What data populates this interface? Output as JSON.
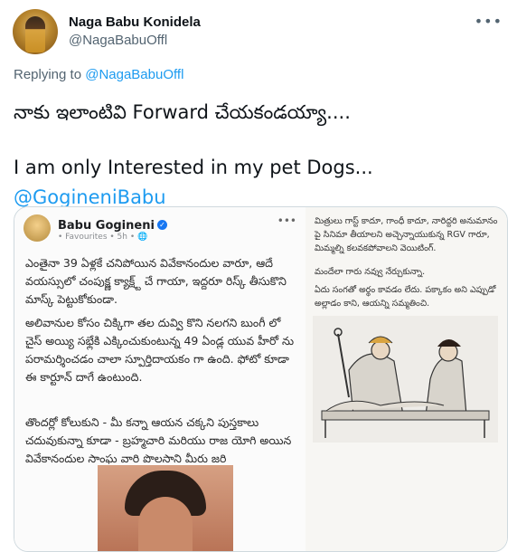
{
  "header": {
    "display_name": "Naga Babu Konidela",
    "handle": "@NagaBabuOffl",
    "more_icon": "more-horizontal-icon"
  },
  "reply": {
    "prefix": "Replying to",
    "to": "@NagaBabuOffl"
  },
  "tweet": {
    "line1": "నాకు ఇలాంటివి Forward చేయకండయ్యా....",
    "line2": "I am only Interested in my pet Dogs...",
    "mention": "@GogineniBabu"
  },
  "media": {
    "post": {
      "author": "Babu Gogineni",
      "meta": "• Favourites • 5h • 🌐",
      "paragraphs": [
        "ఎంతైనా 39 ఏళ్లకే చనిపోయిన వివేకానందుల వారూ, ఆదే వయస్సులో చంపుక్ష్ణ క్యాక్ష్ట్ చే గాయా, ఇద్దరూ రిస్క్ తీసుకొని మాస్క్ పెట్టుకోకుండా.",
        "అలివానుల కోసం చిక్కిగా తల దువ్వి కొని నలగని బుంగీ లో చైస్ అయ్యి సభ్లేకి ఎక్కించుకుంటున్న 49 ఏండ్ల యువ హీరో ను పరామర్శించడం చాలా స్పూర్తిదాయకం గా ఉంది. ఫోటో కూడా ఈ కార్టూన్ దాగే ఉంటుంది.",
        "తొందర్లో కోలుకుని - మీ కన్నా ఆయన చక్కని పుస్తకాలు చదువుకున్నా కూడా - బ్రహ్మచారి మరియు రాజ యోగి అయిన వివేకానందుల సాంఘ వారి పొలసాని మీరు జరి"
      ]
    },
    "cartoon": {
      "texts": [
        "మిత్రులు గాస్ట్ కాదూ, గాంధీ కాదూ, నారిద్దరి అనుమానం పై సినిమా తీయాలని అచ్చెన్నాయుకున్న RGV గారూ, మిమ్మల్ని కలవకపోవాలని వెయిటింగ్.",
        "మందేలా గారు నవ్వు నేర్చుకున్నా.",
        "ఏదు సంగతో అర్థం కావడం లేదు. పక్కాకం అని ఎప్పుడో అల్లాడం కాని, ఆయన్ని సమ్మతించి."
      ]
    }
  }
}
